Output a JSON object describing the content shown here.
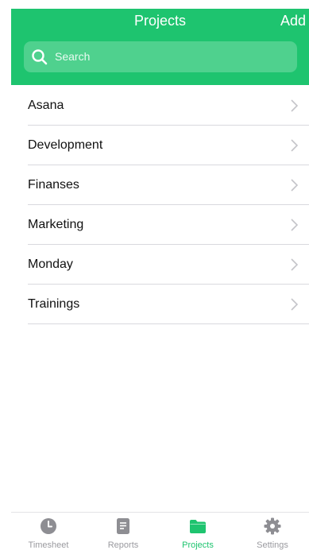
{
  "header": {
    "title": "Projects",
    "add_label": "Add",
    "background_color": "#1ec46f"
  },
  "search": {
    "placeholder": "Search",
    "icon": "search-icon"
  },
  "projects": [
    {
      "name": "Asana"
    },
    {
      "name": "Development"
    },
    {
      "name": "Finanses"
    },
    {
      "name": "Marketing"
    },
    {
      "name": "Monday"
    },
    {
      "name": "Trainings"
    }
  ],
  "tabbar": {
    "active_color": "#1ec46f",
    "inactive_color": "#9a9a9f",
    "tabs": [
      {
        "label": "Timesheet",
        "icon": "clock-icon",
        "active": false
      },
      {
        "label": "Reports",
        "icon": "document-icon",
        "active": false
      },
      {
        "label": "Projects",
        "icon": "folder-icon",
        "active": true
      },
      {
        "label": "Settings",
        "icon": "gear-icon",
        "active": false
      }
    ]
  }
}
